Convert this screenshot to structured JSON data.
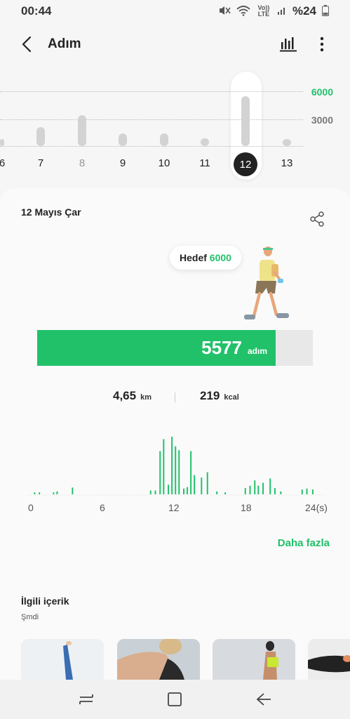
{
  "status_bar": {
    "time": "00:44",
    "network": "Vo)) LTE",
    "battery": "%24",
    "icons": [
      "mute-icon",
      "wifi-icon",
      "signal-icon",
      "battery-icon"
    ]
  },
  "app_bar": {
    "title": "Adım",
    "icons": [
      "back-arrow-icon",
      "bar-chart-icon",
      "more-vert-icon"
    ]
  },
  "weekly_chart": {
    "goal_line_label": "6000",
    "mid_line_label": "3000",
    "days": [
      {
        "label": "6",
        "value": 800
      },
      {
        "label": "7",
        "value": 2100
      },
      {
        "label": "8",
        "value": 3500
      },
      {
        "label": "9",
        "value": 1400
      },
      {
        "label": "10",
        "value": 1400
      },
      {
        "label": "11",
        "value": 900
      },
      {
        "label": "12",
        "value": 5577
      },
      {
        "label": "13",
        "value": 0
      }
    ],
    "selected_day": "12",
    "colors": {
      "goal": "#21c16a",
      "bar": "#d3d3d3",
      "selected": "#222222"
    }
  },
  "summary": {
    "date": "12 Mayıs Çar",
    "goal_prefix": "Hedef",
    "goal_value": "6000",
    "goal": 6000,
    "steps": 5577,
    "steps_text": "5577",
    "steps_unit": "adım",
    "distance": "4,65",
    "distance_unit": "km",
    "calories": "219",
    "calories_unit": "kcal",
    "more_label": "Daha fazla",
    "accent": "#21c16a"
  },
  "hourly_chart": {
    "x_ticks": [
      "0",
      "6",
      "12",
      "18",
      "24(s)"
    ],
    "bars": [
      {
        "hour": 0.2,
        "value": 4
      },
      {
        "hour": 0.6,
        "value": 4
      },
      {
        "hour": 1.8,
        "value": 4
      },
      {
        "hour": 2.1,
        "value": 6
      },
      {
        "hour": 3.4,
        "value": 14
      },
      {
        "hour": 10.0,
        "value": 8
      },
      {
        "hour": 10.4,
        "value": 8
      },
      {
        "hour": 10.8,
        "value": 90
      },
      {
        "hour": 11.1,
        "value": 115
      },
      {
        "hour": 11.5,
        "value": 20
      },
      {
        "hour": 11.8,
        "value": 120
      },
      {
        "hour": 12.1,
        "value": 100
      },
      {
        "hour": 12.4,
        "value": 92
      },
      {
        "hour": 12.8,
        "value": 12
      },
      {
        "hour": 13.1,
        "value": 15
      },
      {
        "hour": 13.4,
        "value": 90
      },
      {
        "hour": 13.7,
        "value": 40
      },
      {
        "hour": 14.3,
        "value": 35
      },
      {
        "hour": 14.8,
        "value": 46
      },
      {
        "hour": 15.6,
        "value": 6
      },
      {
        "hour": 16.3,
        "value": 4
      },
      {
        "hour": 18.0,
        "value": 13
      },
      {
        "hour": 18.4,
        "value": 18
      },
      {
        "hour": 18.8,
        "value": 29
      },
      {
        "hour": 19.1,
        "value": 18
      },
      {
        "hour": 19.5,
        "value": 24
      },
      {
        "hour": 20.1,
        "value": 33
      },
      {
        "hour": 20.5,
        "value": 13
      },
      {
        "hour": 21.0,
        "value": 6
      },
      {
        "hour": 22.8,
        "value": 10
      },
      {
        "hour": 23.2,
        "value": 12
      },
      {
        "hour": 23.7,
        "value": 10
      }
    ]
  },
  "related": {
    "title": "İlgili içerik",
    "subtitle": "Şmdi",
    "thumbnails": [
      "yoga-thumbnail",
      "arm-stretch-thumbnail",
      "side-stretch-thumbnail",
      "floor-exercise-thumbnail"
    ]
  },
  "nav_bar": {
    "icons": [
      "recents-icon",
      "home-icon",
      "back-icon"
    ]
  }
}
